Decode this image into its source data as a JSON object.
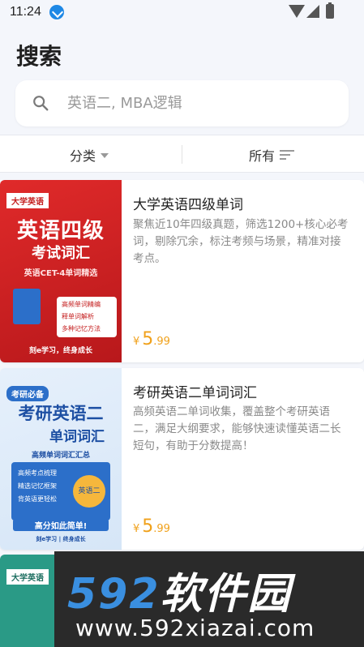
{
  "status_bar": {
    "time": "11:24"
  },
  "page": {
    "title": "搜索"
  },
  "search": {
    "placeholder": "英语二, MBA逻辑"
  },
  "filters": {
    "category_label": "分类",
    "sort_label": "所有"
  },
  "books": [
    {
      "title": "大学英语四级单词",
      "description": "聚焦近10年四级真题，筛选1200+核心必考词，剔除冗余，标注考频与场景，精准对接考点。",
      "price_symbol": "¥",
      "price_integer": "5",
      "price_decimal": ".99",
      "cover": {
        "tag": "大学英语",
        "title_line1": "英语四级",
        "title_line2": "考试词汇",
        "subtitle": "英语CET-4单词精选",
        "bullets": [
          "高频单词精编",
          "释单词解析",
          "多种记忆方法"
        ],
        "footer": "刻e学习，终身成长"
      }
    },
    {
      "title": "考研英语二单词词汇",
      "description": "高频英语二单词收集，覆盖整个考研英语二，满足大纲要求，能够快速读懂英语二长短句，有助于分数提高！",
      "price_symbol": "¥",
      "price_integer": "5",
      "price_decimal": ".99",
      "cover": {
        "tag": "考研必备",
        "title_line1": "考研英语二",
        "title_line2": "单词词汇",
        "subtitle": "高频单词词汇汇总",
        "bullets": [
          "高频考点梳理",
          "精选记忆框架",
          "背英语更轻松"
        ],
        "badge": "英语二",
        "banner": "高分如此简单!",
        "footer": "刻e学习 | 终身成长"
      }
    },
    {
      "cover": {
        "tag": "大学英语"
      }
    }
  ],
  "watermark": {
    "numbers": "592",
    "name": "软件园",
    "url": "www.592xiazai.com"
  },
  "colors": {
    "accent_blue": "#1e88e5",
    "price_orange": "#f0a11b",
    "cover_red": "#d32222"
  }
}
